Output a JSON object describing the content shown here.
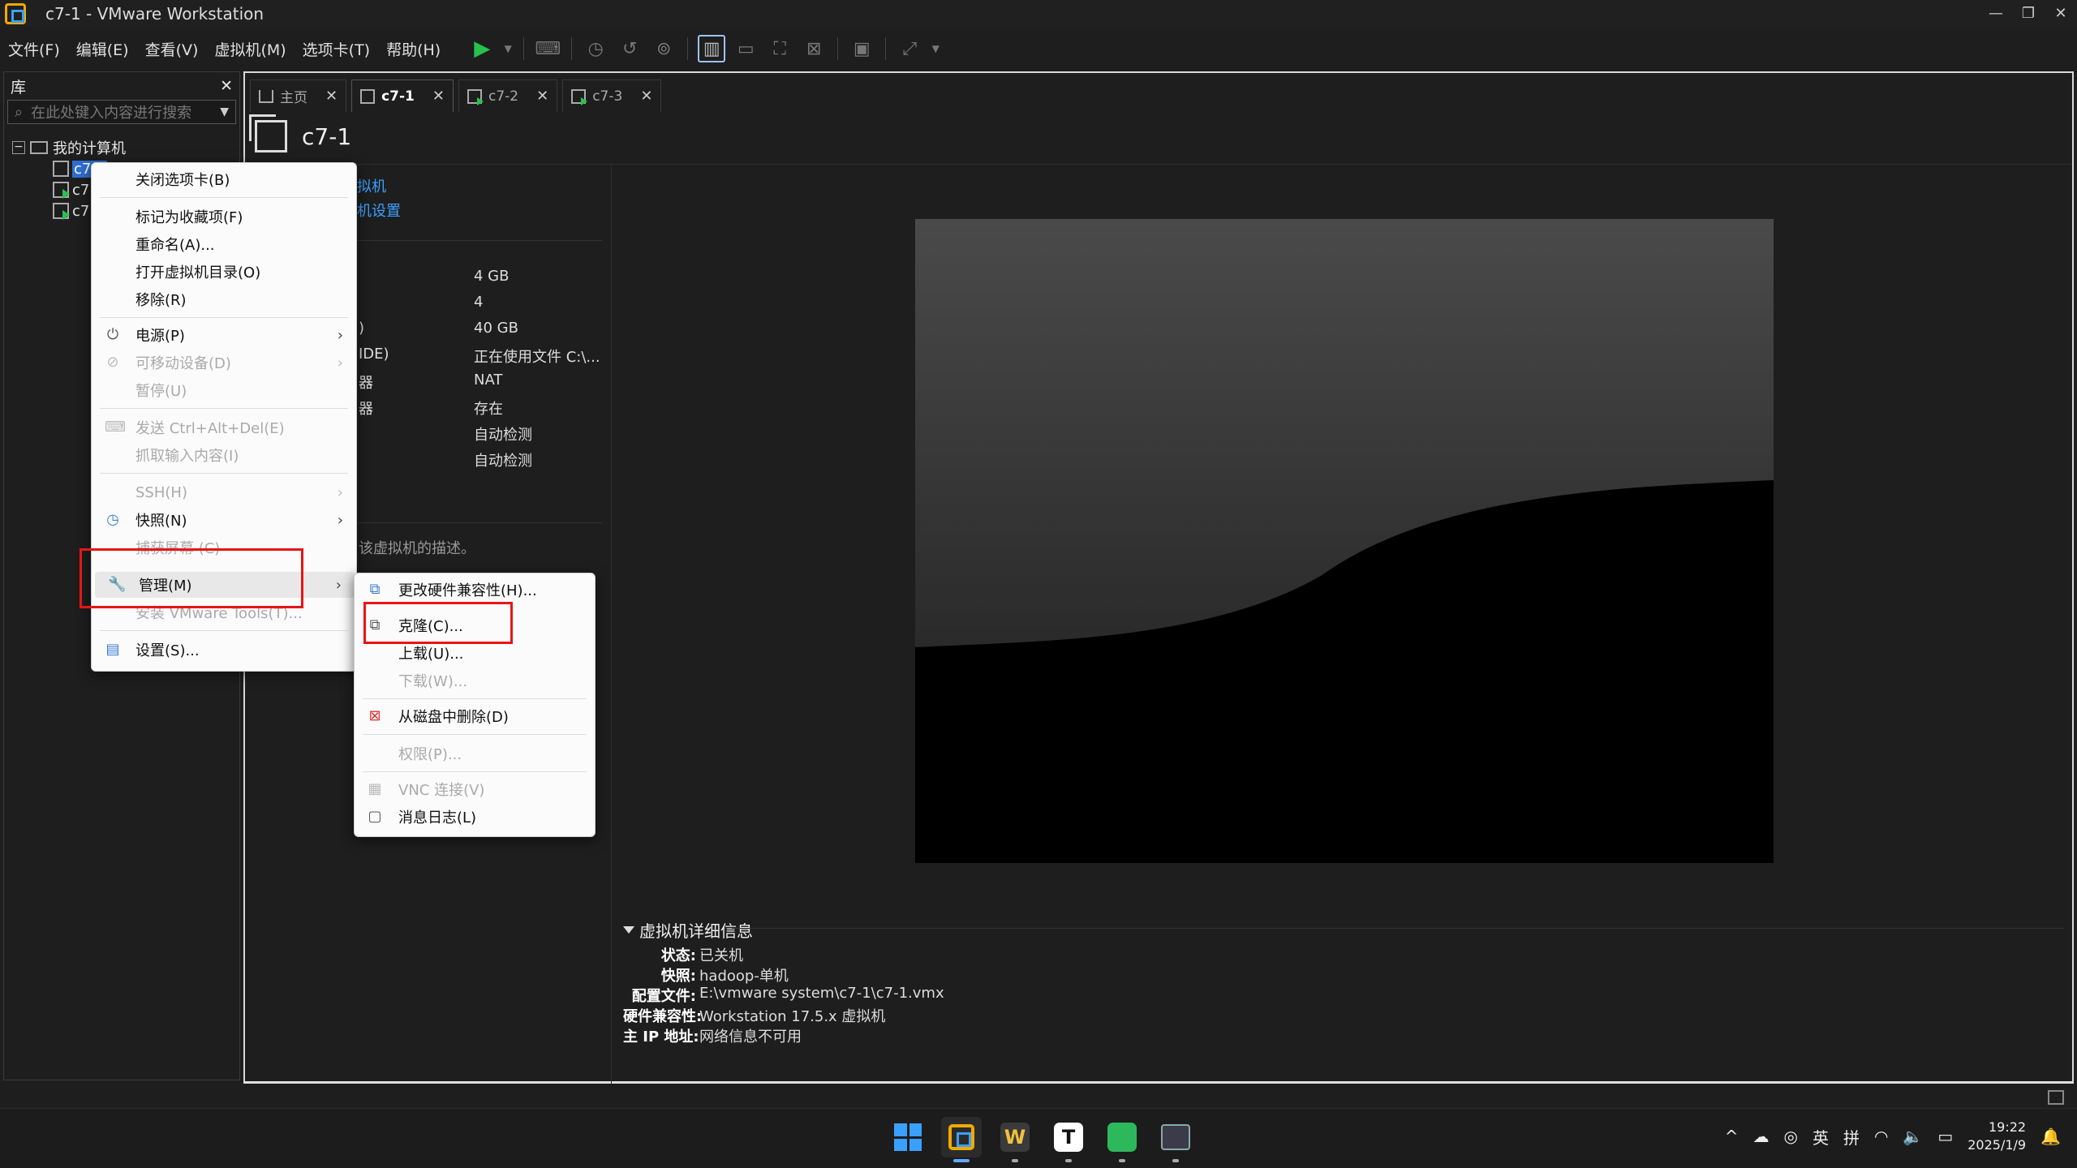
{
  "window": {
    "title": "c7-1 - VMware Workstation",
    "controls": [
      "—",
      "❐",
      "✕"
    ]
  },
  "menubar": {
    "items": [
      "文件(F)",
      "编辑(E)",
      "查看(V)",
      "虚拟机(M)",
      "选项卡(T)",
      "帮助(H)"
    ]
  },
  "library": {
    "title": "库",
    "close": "✕",
    "search_placeholder": "在此处键入内容进行搜索",
    "root": "我的计算机",
    "vms": [
      "c7-1",
      "c7",
      "c7"
    ]
  },
  "tabs": [
    {
      "label": "主页"
    },
    {
      "label": "c7-1"
    },
    {
      "label": "c7-2"
    },
    {
      "label": "c7-3"
    }
  ],
  "vm": {
    "name": "c7-1",
    "links": [
      "拟机",
      "机设置"
    ],
    "hardware": [
      {
        "label": "",
        "value": "4 GB"
      },
      {
        "label": "",
        "value": "4"
      },
      {
        "label": ")",
        "value": "40 GB"
      },
      {
        "label": "IDE)",
        "value": "正在使用文件 C:\\..."
      },
      {
        "label": "器",
        "value": "NAT"
      },
      {
        "label": "器",
        "value": "存在"
      },
      {
        "label": "",
        "value": "自动检测"
      },
      {
        "label": "",
        "value": "自动检测"
      }
    ],
    "description": "该虚拟机的描述。"
  },
  "details": {
    "heading": "虚拟机详细信息",
    "rows": [
      {
        "label": "状态:",
        "value": "已关机"
      },
      {
        "label": "快照:",
        "value": "hadoop-单机"
      },
      {
        "label": "配置文件:",
        "value": "E:\\vmware system\\c7-1\\c7-1.vmx"
      },
      {
        "label": "硬件兼容性:",
        "value": "Workstation 17.5.x 虚拟机"
      },
      {
        "label": "主 IP 地址:",
        "value": "网络信息不可用"
      }
    ]
  },
  "context_menu": {
    "items": [
      {
        "label": "关闭选项卡(B)",
        "disabled": false
      },
      {
        "label": "标记为收藏项(F)",
        "disabled": false
      },
      {
        "label": "重命名(A)...",
        "disabled": false
      },
      {
        "label": "打开虚拟机目录(O)",
        "disabled": false
      },
      {
        "label": "移除(R)",
        "disabled": false
      },
      {
        "label": "电源(P)",
        "disabled": false
      },
      {
        "label": "可移动设备(D)",
        "disabled": true
      },
      {
        "label": "暂停(U)",
        "disabled": true
      },
      {
        "label": "发送 Ctrl+Alt+Del(E)",
        "disabled": true
      },
      {
        "label": "抓取输入内容(I)",
        "disabled": true
      },
      {
        "label": "SSH(H)",
        "disabled": true
      },
      {
        "label": "快照(N)",
        "disabled": false
      },
      {
        "label": "捕获屏幕 (C)",
        "disabled": true
      },
      {
        "label": "管理(M)",
        "disabled": false
      },
      {
        "label": "安装 VMware Tools(T)...",
        "disabled": true
      },
      {
        "label": "设置(S)...",
        "disabled": false
      }
    ]
  },
  "submenu": {
    "items": [
      {
        "label": "更改硬件兼容性(H)...",
        "disabled": false
      },
      {
        "label": "克隆(C)...",
        "disabled": false
      },
      {
        "label": "上载(U)...",
        "disabled": false
      },
      {
        "label": "下载(W)...",
        "disabled": true
      },
      {
        "label": "从磁盘中删除(D)",
        "disabled": false
      },
      {
        "label": "权限(P)...",
        "disabled": true
      },
      {
        "label": "VNC 连接(V)",
        "disabled": true
      },
      {
        "label": "消息日志(L)",
        "disabled": false
      }
    ]
  },
  "taskbar": {
    "apps": [
      "windows-start",
      "vmware-workstation",
      "wps-office",
      "typora",
      "green-app",
      "snipping-tool"
    ],
    "wps_letter": "W",
    "t_letter": "T",
    "tray": {
      "chevron": "^",
      "lang_en": "英",
      "lang_pin": "拼",
      "time": "19:22",
      "date": "2025/1/9"
    }
  }
}
